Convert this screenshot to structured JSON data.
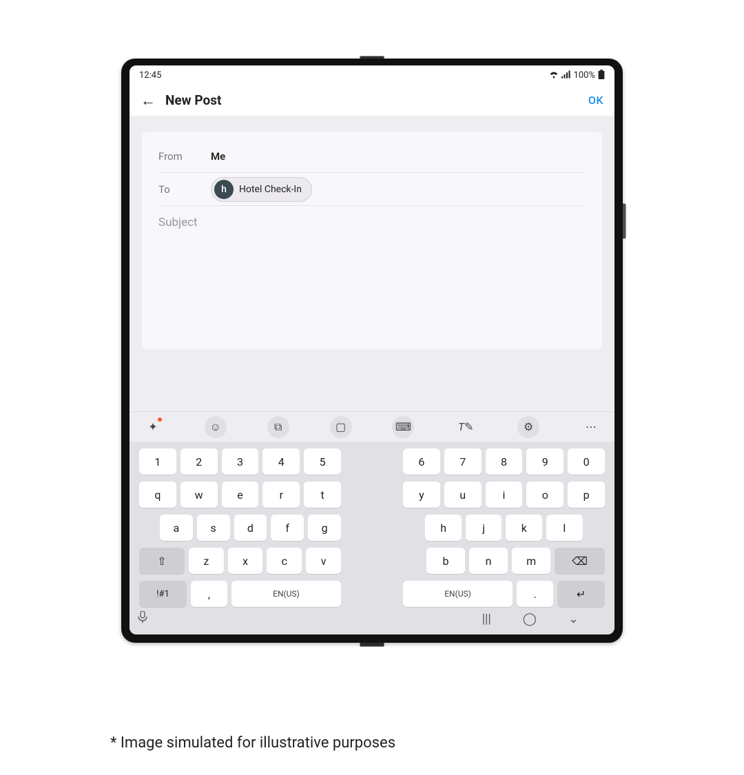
{
  "status": {
    "time": "12:45",
    "battery": "100%"
  },
  "header": {
    "title": "New Post",
    "ok": "OK"
  },
  "compose": {
    "from_label": "From",
    "from_value": "Me",
    "to_label": "To",
    "chip_letter": "h",
    "chip_text": "Hotel Check-In",
    "subject_placeholder": "Subject"
  },
  "keyboard": {
    "toolbar": [
      "sparkle",
      "smile",
      "translate",
      "clipboard",
      "keyboard-mini",
      "handwriting",
      "settings",
      "more"
    ],
    "left": {
      "row1": [
        "1",
        "2",
        "3",
        "4",
        "5"
      ],
      "row2": [
        "q",
        "w",
        "e",
        "r",
        "t"
      ],
      "row3": [
        "a",
        "s",
        "d",
        "f",
        "g"
      ],
      "row4": [
        "⇧",
        "z",
        "x",
        "c",
        "v"
      ],
      "row5_sym": "!#1",
      "row5_comma": ",",
      "row5_space": "EN(US)"
    },
    "right": {
      "row1": [
        "6",
        "7",
        "8",
        "9",
        "0"
      ],
      "row2": [
        "y",
        "u",
        "i",
        "o",
        "p"
      ],
      "row3": [
        "h",
        "j",
        "k",
        "l"
      ],
      "row4": [
        "b",
        "n",
        "m",
        "⌫"
      ],
      "row5_space": "EN(US)",
      "row5_period": ".",
      "row5_enter": "↵"
    }
  },
  "footnote": "* Image simulated for illustrative purposes"
}
